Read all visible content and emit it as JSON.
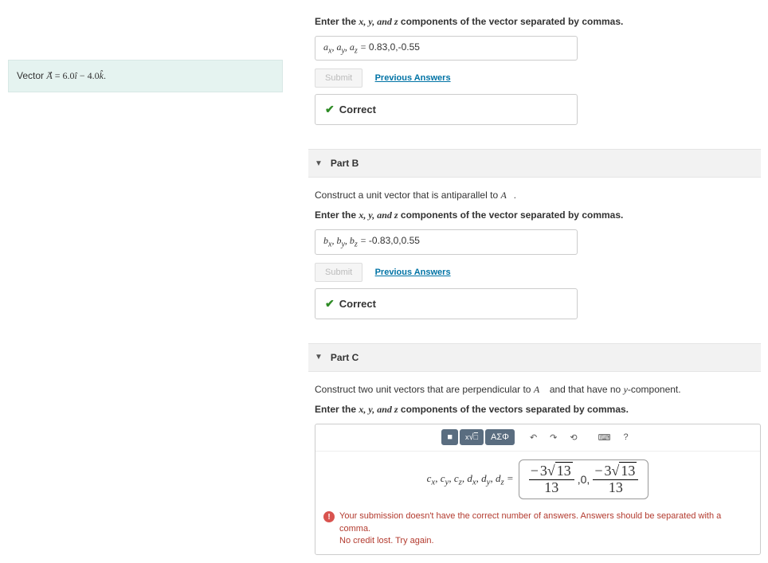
{
  "problem": {
    "prefix": "Vector ",
    "expr_html": "A⃗ = 6.0î − 4.0k̂."
  },
  "partA": {
    "instruction_pre": "Enter the ",
    "vars": "x, y, and z",
    "instruction_post": " components of the vector separated by commas.",
    "lhs": "aₓ, a_y, a_z = ",
    "value": "0.83,0,-0.55",
    "submit": "Submit",
    "prev": "Previous Answers",
    "correct": "Correct"
  },
  "partB": {
    "title": "Part B",
    "prompt": "Construct a unit vector that is antiparallel to ",
    "prompt_vec": "A⃗.",
    "instruction_pre": "Enter the ",
    "vars": "x, y, and z",
    "instruction_post": " components of the vector separated by commas.",
    "lhs": "bₓ, b_y, b_z = ",
    "value": "-0.83,0,0.55",
    "submit": "Submit",
    "prev": "Previous Answers",
    "correct": "Correct"
  },
  "partC": {
    "title": "Part C",
    "prompt_a": "Construct two unit vectors that are perpendicular to ",
    "prompt_vec": "A⃗",
    "prompt_b": " and that have no ",
    "prompt_yvar": "y",
    "prompt_c": "-component.",
    "instruction_pre": "Enter the ",
    "vars": "x, y, and z",
    "instruction_post": " components of the vectors separated by commas.",
    "lhs": "cₓ, c_y, c_z, dₓ, d_y, d_z = ",
    "frac1_num": "− 3√13",
    "frac1_den": "13",
    "mid": ",0,",
    "frac2_num": "− 3√13",
    "frac2_den": "13",
    "toolbar": {
      "t1": "■",
      "t2": "√□",
      "t3": "ΑΣΦ",
      "undo": "↶",
      "redo": "↷",
      "reset": "⟲",
      "kb": "⌨",
      "help": "?"
    },
    "error1": "Your submission doesn't have the correct number of answers. Answers should be separated with a comma.",
    "error2": "No credit lost. Try again."
  }
}
